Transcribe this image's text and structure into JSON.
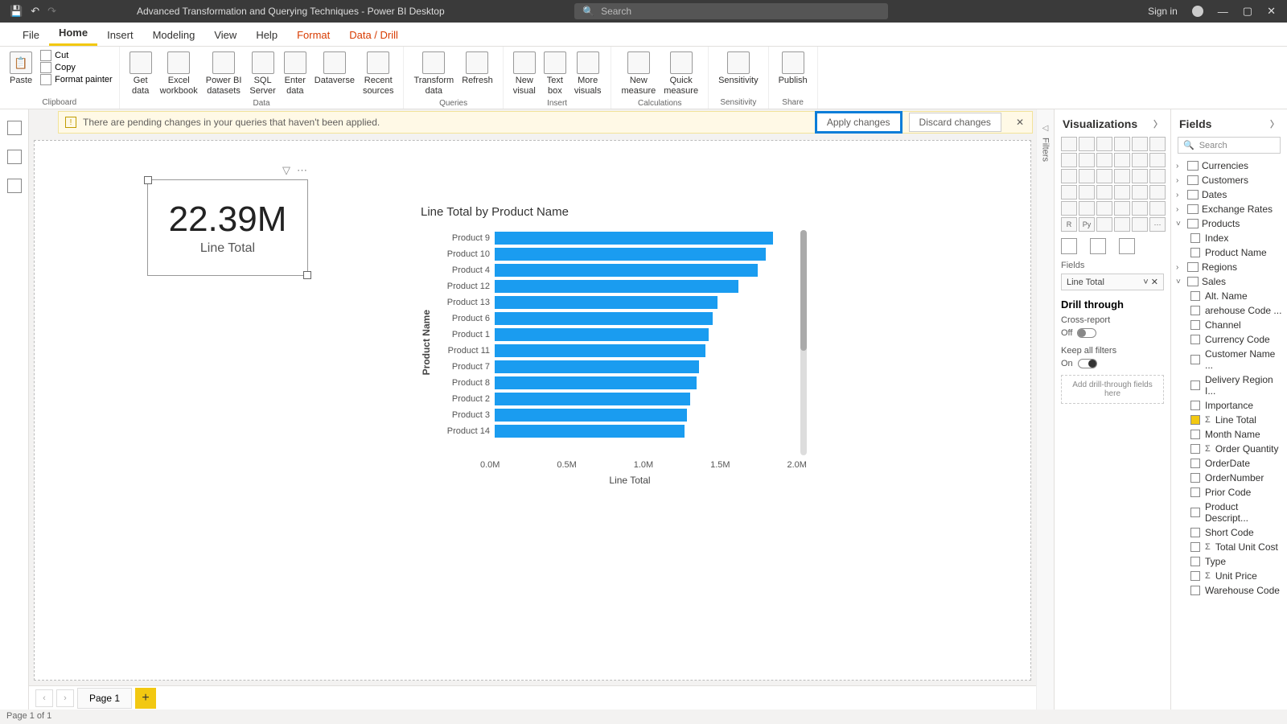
{
  "titlebar": {
    "title": "Advanced Transformation and Querying Techniques - Power BI Desktop",
    "search_placeholder": "Search",
    "signin": "Sign in"
  },
  "tabs": [
    "File",
    "Home",
    "Insert",
    "Modeling",
    "View",
    "Help",
    "Format",
    "Data / Drill"
  ],
  "active_tab": "Home",
  "ribbon": {
    "clipboard": {
      "label": "Clipboard",
      "paste": "Paste",
      "cut": "Cut",
      "copy": "Copy",
      "fp": "Format painter"
    },
    "data": {
      "label": "Data",
      "items": [
        "Get\ndata",
        "Excel\nworkbook",
        "Power BI\ndatasets",
        "SQL\nServer",
        "Enter\ndata",
        "Dataverse",
        "Recent\nsources"
      ]
    },
    "queries": {
      "label": "Queries",
      "items": [
        "Transform\ndata",
        "Refresh"
      ]
    },
    "insert": {
      "label": "Insert",
      "items": [
        "New\nvisual",
        "Text\nbox",
        "More\nvisuals"
      ]
    },
    "calc": {
      "label": "Calculations",
      "items": [
        "New\nmeasure",
        "Quick\nmeasure"
      ]
    },
    "sens": {
      "label": "Sensitivity",
      "items": [
        "Sensitivity"
      ]
    },
    "share": {
      "label": "Share",
      "items": [
        "Publish"
      ]
    }
  },
  "infobar": {
    "msg": "There are pending changes in your queries that haven't been applied.",
    "apply": "Apply changes",
    "discard": "Discard changes"
  },
  "card": {
    "value": "22.39M",
    "label": "Line Total"
  },
  "chart_data": {
    "type": "bar",
    "title": "Line Total by Product Name",
    "xlabel": "Line Total",
    "ylabel": "Product Name",
    "xlim": [
      0,
      2.0
    ],
    "xticks": [
      "0.0M",
      "0.5M",
      "1.0M",
      "1.5M",
      "2.0M"
    ],
    "categories": [
      "Product 9",
      "Product 10",
      "Product 4",
      "Product 12",
      "Product 13",
      "Product 6",
      "Product 1",
      "Product 11",
      "Product 7",
      "Product 8",
      "Product 2",
      "Product 3",
      "Product 14"
    ],
    "values": [
      1.85,
      1.8,
      1.75,
      1.62,
      1.48,
      1.45,
      1.42,
      1.4,
      1.36,
      1.34,
      1.3,
      1.28,
      1.26
    ]
  },
  "viz_panel": {
    "title": "Visualizations",
    "fields_label": "Fields",
    "well_value": "Line Total",
    "drill": "Drill through",
    "cross": "Cross-report",
    "off": "Off",
    "keep": "Keep all filters",
    "on": "On",
    "drop": "Add drill-through fields here"
  },
  "fields_panel": {
    "title": "Fields",
    "search": "Search",
    "tables": [
      {
        "name": "Currencies",
        "expanded": false
      },
      {
        "name": "Customers",
        "expanded": false
      },
      {
        "name": "Dates",
        "expanded": false
      },
      {
        "name": "Exchange Rates",
        "expanded": false
      },
      {
        "name": "Products",
        "expanded": true,
        "fields": [
          {
            "n": "Index"
          },
          {
            "n": "Product Name"
          }
        ]
      },
      {
        "name": "Regions",
        "expanded": false
      },
      {
        "name": "Sales",
        "expanded": true,
        "fields": [
          {
            "n": "Alt. Name"
          },
          {
            "n": "arehouse Code ..."
          },
          {
            "n": "Channel"
          },
          {
            "n": "Currency Code"
          },
          {
            "n": "Customer Name ..."
          },
          {
            "n": "Delivery Region I..."
          },
          {
            "n": "Importance"
          },
          {
            "n": "Line Total",
            "checked": true,
            "sigma": true
          },
          {
            "n": "Month Name"
          },
          {
            "n": "Order Quantity",
            "sigma": true
          },
          {
            "n": "OrderDate"
          },
          {
            "n": "OrderNumber"
          },
          {
            "n": "Prior Code"
          },
          {
            "n": "Product Descript..."
          },
          {
            "n": "Short Code"
          },
          {
            "n": "Total Unit Cost",
            "sigma": true
          },
          {
            "n": "Type"
          },
          {
            "n": "Unit Price",
            "sigma": true
          },
          {
            "n": "Warehouse Code"
          }
        ]
      }
    ]
  },
  "filters_label": "Filters",
  "page": {
    "tab": "Page 1",
    "status": "Page 1 of 1"
  }
}
